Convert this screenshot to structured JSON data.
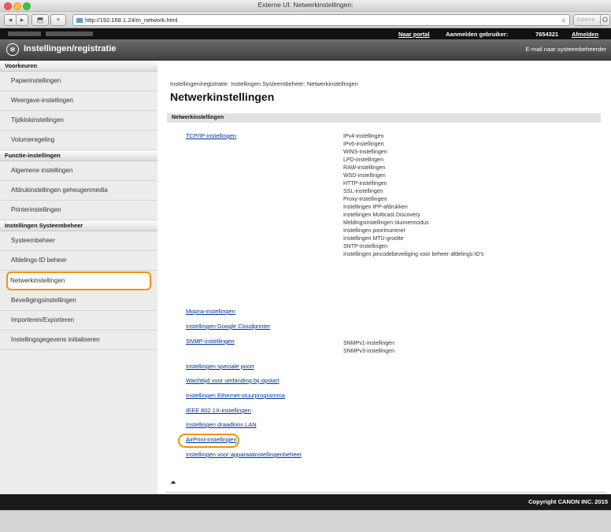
{
  "window": {
    "title": "Externe UI: Netwerkinstellingen: "
  },
  "toolbar": {
    "url": "http://192.168.1.24/m_network.html",
    "reload_symbol": "c",
    "search_placeholder": "Zoeken"
  },
  "topbar": {
    "portal": "Naar portal",
    "login_user_label": "Aanmelden gebruiker:",
    "user_id": "7654321",
    "logout": "Afmelden"
  },
  "header": {
    "title": "Instellingen/registratie",
    "mail_admin": "E-mail naar systeembeheerder"
  },
  "sidebar": {
    "sections": [
      {
        "heading": "Voorkeuren",
        "items": [
          "Papierinstellingen",
          "Weergave-instellingen",
          "Tijdklokinstellingen",
          "Volumeregeling"
        ]
      },
      {
        "heading": "Functie-instellingen",
        "items": [
          "Algemene instellingen",
          "Afdrukinstellingen geheugenmedia",
          "Printerinstellingen"
        ]
      },
      {
        "heading": "Instellingen Systeembeheer",
        "items": [
          "Systeembeheer",
          "Afdelings-ID beheer",
          "Netwerkinstellingen",
          "Beveiligingsinstellingen",
          "Importeren/Exporteren",
          "Instellingsgegevens initialiseren"
        ]
      }
    ]
  },
  "main": {
    "breadcrumb": "Instellingen/registratie: Instellingen Systeembeheer: Netwerkinstellingen",
    "title": "Netwerkinstellingen",
    "section_heading": "Netwerkinstellingen",
    "links": [
      "TCP/IP-instellingen",
      "Mopria-instellingen",
      "Instellingen Google Cloudprinter",
      "SNMP-instellingen",
      "Instellingen speciale poort",
      "Wachttijd voor verbinding bij opstart",
      "Instellingen Ethernet-stuurprogramma",
      "IEEE 802.1X-instellingen",
      "Instellingen draadloos LAN",
      "AirPrint-instellingen",
      "Instellingen voor apparaatinstellingenbeheer"
    ],
    "tcpip_sub": [
      "IPv4-instellingen",
      "IPv6-instellingen",
      "WINS-instellingen",
      "LPD-instellingen",
      "RAW-instellingen",
      "WSD-instellingen",
      "HTTP-instellingen",
      "SSL-instellingen",
      "Proxy-instellingen",
      "Instellingen IPP-afdrukken",
      "Instellingen Multicast Discovery",
      "Meldingsinstellingen sluimermodus",
      "Instellingen poortnummer",
      "Instellingen MTU-grootte",
      "SNTP-instellingen",
      "Instellingen pincodebeveiliging voor beheer afdelings-ID's"
    ],
    "snmp_sub": [
      "SNMPv1-instellingen",
      "SNMPv3-instellingen"
    ],
    "top_icon": "⏶"
  },
  "footer": {
    "copyright": "Copyright CANON INC. 2015"
  },
  "colors": {
    "highlight": "#f39200",
    "link": "#003399"
  }
}
